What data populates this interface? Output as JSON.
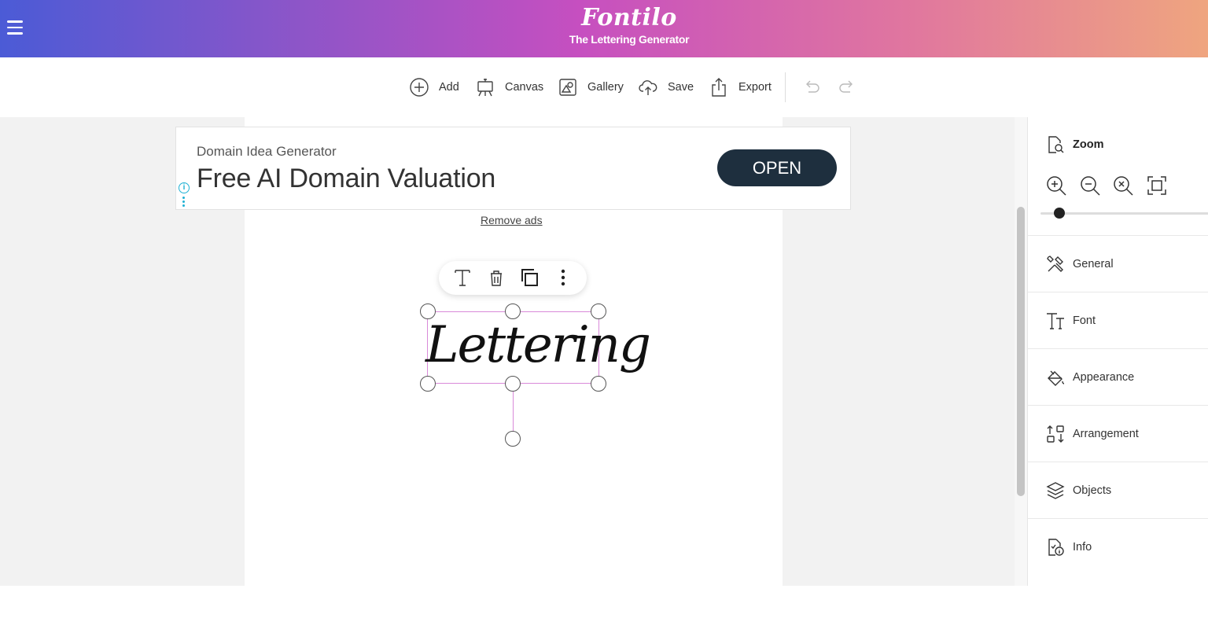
{
  "header": {
    "logo": "Fontilo",
    "subtitle": "The Lettering Generator",
    "menu_icon": "hamburger-icon"
  },
  "toolbar": {
    "items": [
      {
        "label": "Add",
        "icon": "plus-circle-icon"
      },
      {
        "label": "Canvas",
        "icon": "easel-icon"
      },
      {
        "label": "Gallery",
        "icon": "gallery-icon"
      },
      {
        "label": "Save",
        "icon": "cloud-upload-icon"
      },
      {
        "label": "Export",
        "icon": "share-icon"
      }
    ],
    "undo_icon": "undo-icon",
    "redo_icon": "redo-icon"
  },
  "ad": {
    "sub": "Domain Idea Generator",
    "title": "Free AI Domain Valuation",
    "cta": "OPEN",
    "info_glyph": "i"
  },
  "remove_ads": "Remove ads",
  "canvas": {
    "text": "Lettering",
    "float_toolbar": [
      "text-icon",
      "trash-icon",
      "duplicate-icon",
      "more-vertical-icon"
    ]
  },
  "panel": {
    "zoom_label": "Zoom",
    "zoom_level": 0.05,
    "zoom_buttons": [
      "zoom-in-icon",
      "zoom-out-icon",
      "zoom-reset-icon",
      "fit-screen-icon"
    ],
    "sections": [
      {
        "label": "General",
        "icon": "tools-icon"
      },
      {
        "label": "Font",
        "icon": "font-icon"
      },
      {
        "label": "Appearance",
        "icon": "paint-bucket-icon"
      },
      {
        "label": "Arrangement",
        "icon": "arrange-icon"
      },
      {
        "label": "Objects",
        "icon": "layers-icon"
      },
      {
        "label": "Info",
        "icon": "info-icon"
      }
    ]
  },
  "colors": {
    "gradient_start": "#4b5bd6",
    "gradient_mid": "#c64fc0",
    "gradient_end": "#efa57f",
    "cta_bg": "#1e2f3e",
    "selection": "#d98ad9"
  }
}
